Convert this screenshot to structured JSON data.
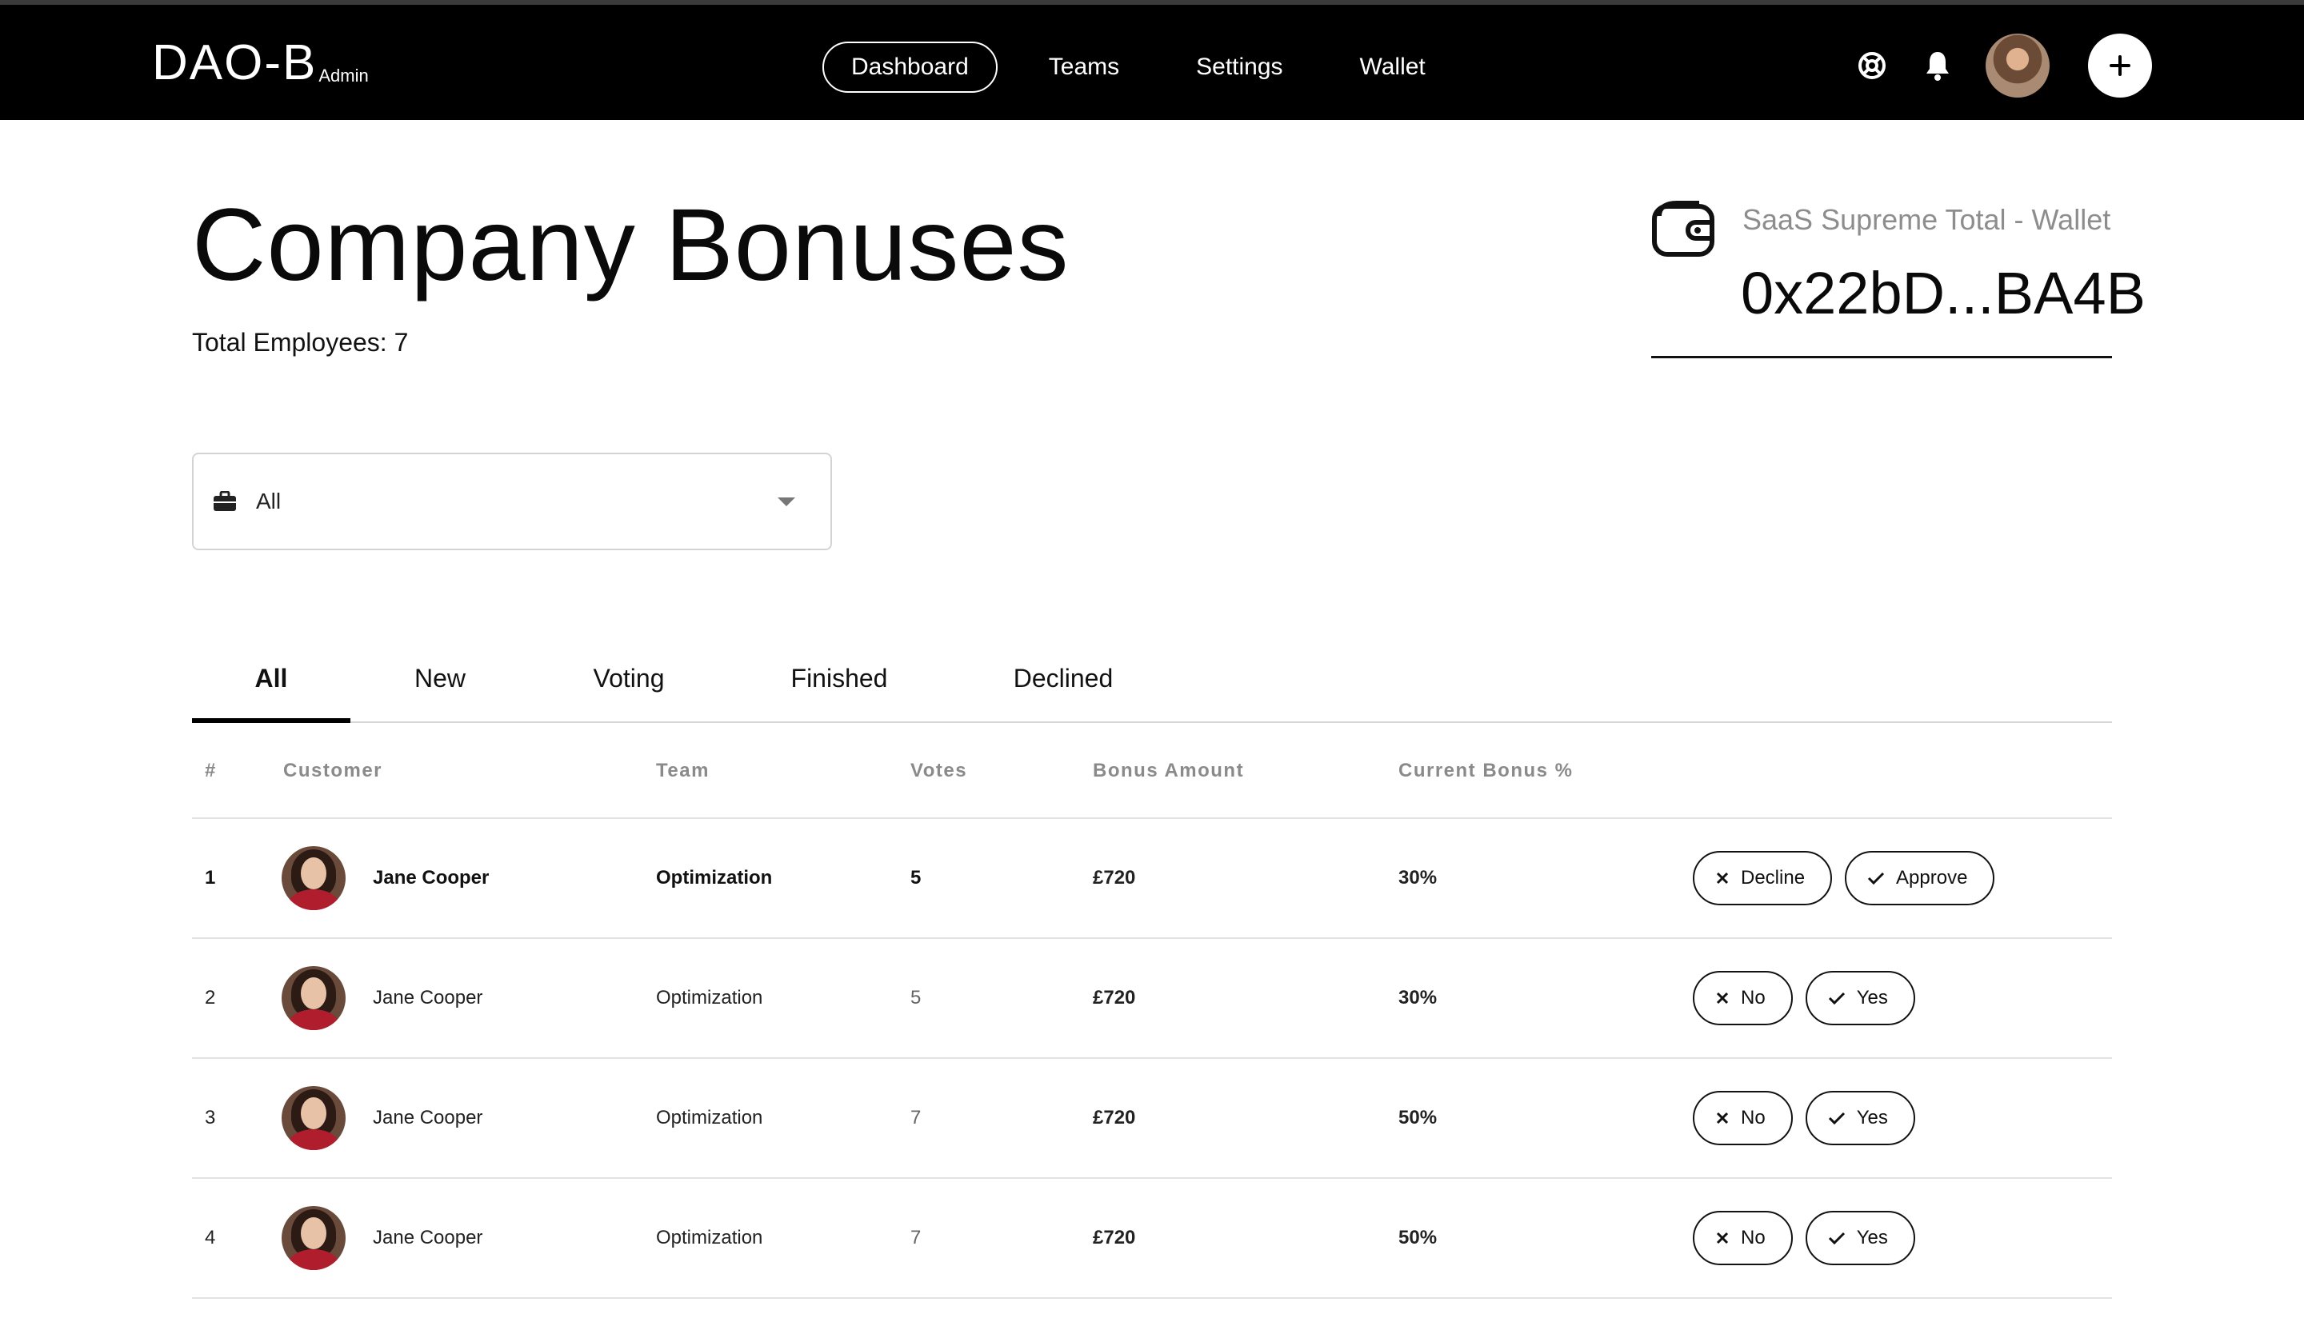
{
  "app": {
    "logo_main": "DAO-B",
    "logo_sub": "Admin"
  },
  "nav": {
    "items": [
      {
        "label": "Dashboard",
        "active": true
      },
      {
        "label": "Teams",
        "active": false
      },
      {
        "label": "Settings",
        "active": false
      },
      {
        "label": "Wallet",
        "active": false
      }
    ],
    "icons": [
      "support-icon",
      "bell-icon",
      "user-avatar",
      "plus-icon"
    ]
  },
  "header": {
    "title": "Company Bonuses",
    "total_employees": "Total Employees: 7"
  },
  "wallet": {
    "label": "SaaS Supreme Total - Wallet",
    "address": "0x22bD...BA4B",
    "icon": "wallet-icon"
  },
  "filter": {
    "icon": "briefcase-icon",
    "value": "All"
  },
  "tabs": [
    {
      "label": "All",
      "active": true
    },
    {
      "label": "New",
      "active": false
    },
    {
      "label": "Voting",
      "active": false
    },
    {
      "label": "Finished",
      "active": false
    },
    {
      "label": "Declined",
      "active": false
    }
  ],
  "table": {
    "columns": [
      "#",
      "Customer",
      "Team",
      "Votes",
      "Bonus Amount",
      "Current Bonus %"
    ],
    "rows": [
      {
        "num": "1",
        "customer": "Jane Cooper",
        "team": "Optimization",
        "votes": "5",
        "amount": "£720",
        "pct": "30%",
        "decline": "Decline",
        "approve": "Approve",
        "strong": true
      },
      {
        "num": "2",
        "customer": "Jane Cooper",
        "team": "Optimization",
        "votes": "5",
        "amount": "£720",
        "pct": "30%",
        "decline": "No",
        "approve": "Yes",
        "strong": false
      },
      {
        "num": "3",
        "customer": "Jane Cooper",
        "team": "Optimization",
        "votes": "7",
        "amount": "£720",
        "pct": "50%",
        "decline": "No",
        "approve": "Yes",
        "strong": false
      },
      {
        "num": "4",
        "customer": "Jane Cooper",
        "team": "Optimization",
        "votes": "7",
        "amount": "£720",
        "pct": "50%",
        "decline": "No",
        "approve": "Yes",
        "strong": false
      }
    ]
  },
  "colors": {
    "topbar": "#000000",
    "muted_text": "#8d8d8d",
    "border": "#e2e2e2"
  }
}
